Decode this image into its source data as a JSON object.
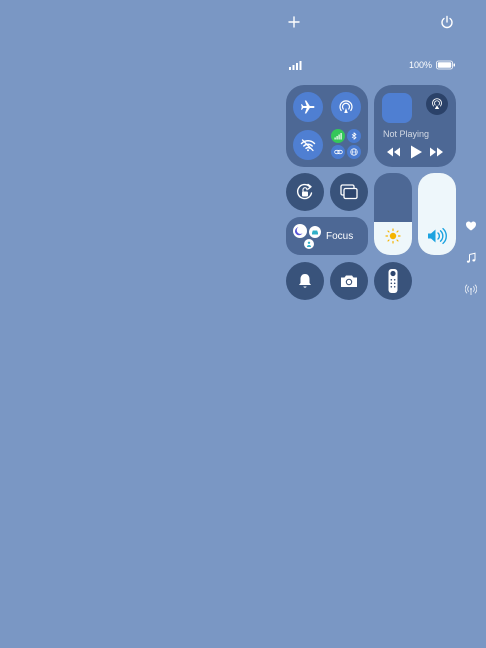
{
  "header": {
    "add_icon": "plus-icon",
    "power_icon": "power-icon"
  },
  "status": {
    "battery_text": "100%",
    "battery_level": 1.0,
    "signal_bars": 4
  },
  "connectivity": {
    "airplane_mode": {
      "icon": "airplane-icon",
      "active": true
    },
    "airdrop": {
      "icon": "airdrop-icon",
      "active": true
    },
    "wifi": {
      "icon": "wifi-icon",
      "active": true
    },
    "cellular": {
      "icon": "cellular-icon",
      "active": true
    },
    "bluetooth": {
      "icon": "bluetooth-icon",
      "active": true
    },
    "hotspot": {
      "icon": "link-icon",
      "active": true
    },
    "vpn": {
      "icon": "globe-icon",
      "active": true
    }
  },
  "media": {
    "status": "Not Playing",
    "airplay_icon": "airplay-icon"
  },
  "controls": {
    "rotation_lock": "rotation-lock-icon",
    "screen_mirroring": "screen-mirror-icon",
    "focus_label": "Focus",
    "brightness_level": 0.4,
    "volume_level": 1.0,
    "bell": "bell-icon",
    "camera": "camera-icon",
    "remote": "remote-icon"
  },
  "side": {
    "heart": "heart-icon",
    "music": "music-note-icon",
    "signal": "antenna-icon"
  },
  "colors": {
    "background": "#7a97c4",
    "tile": "#3c5682",
    "active_blue": "#4f7fd2",
    "active_green": "#34c759",
    "volume_blue": "#1ca3e0"
  }
}
